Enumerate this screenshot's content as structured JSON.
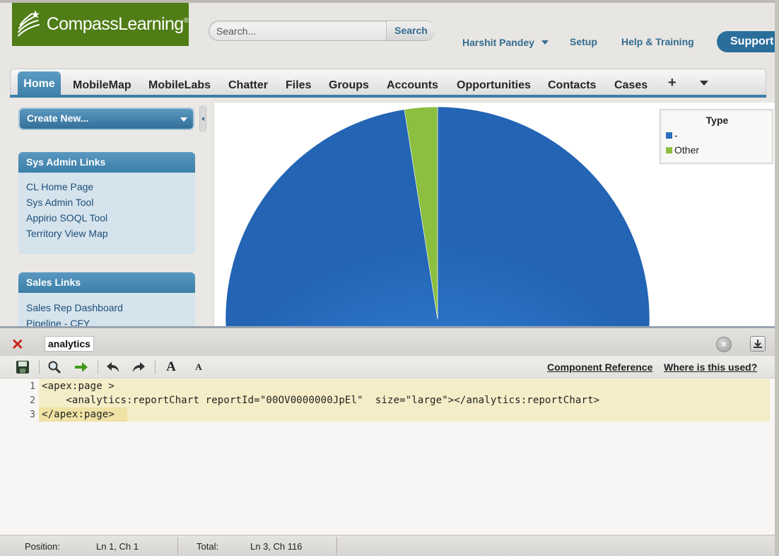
{
  "header": {
    "logo_text": "CompassLearning",
    "logo_mark": "®",
    "search_placeholder": "Search...",
    "search_button": "Search",
    "user_name": "Harshit Pandey",
    "setup": "Setup",
    "help": "Help & Training",
    "support": "Support"
  },
  "tabs": [
    "Home",
    "MobileMap",
    "MobileLabs",
    "Chatter",
    "Files",
    "Groups",
    "Accounts",
    "Opportunities",
    "Contacts",
    "Cases"
  ],
  "tab_plus": "+",
  "sidebar": {
    "create_new": "Create New...",
    "sys_admin": {
      "title": "Sys Admin Links",
      "links": [
        "CL Home Page",
        "Sys Admin Tool",
        "Appirio SOQL Tool",
        "Territory View Map"
      ]
    },
    "sales": {
      "title": "Sales Links",
      "links": [
        "Sales Rep Dashboard",
        "Pipeline - CFY"
      ]
    }
  },
  "chart_data": {
    "type": "pie",
    "legend_title": "Type",
    "legend_position": "top-right",
    "slices": [
      {
        "label": "-",
        "value": 97.5,
        "color": "#2a6fc0"
      },
      {
        "label": "Other",
        "value": 2.5,
        "color": "#8cbf3f"
      }
    ]
  },
  "console": {
    "page_name": "analytics",
    "close_glyph": "✕",
    "component_reference": "Component Reference",
    "where_used": "Where is this used?",
    "font_big": "A",
    "font_small": "A",
    "line_numbers": [
      "1",
      "2",
      "3"
    ],
    "code_lines": [
      "<apex:page >",
      "    <analytics:reportChart reportId=\"00OV0000000JpEl\"  size=\"large\"></analytics:reportChart>",
      "</apex:page>"
    ],
    "status": {
      "position_label": "Position:",
      "position_value": "Ln 1, Ch 1",
      "total_label": "Total:",
      "total_value": "Ln 3, Ch 116"
    }
  }
}
